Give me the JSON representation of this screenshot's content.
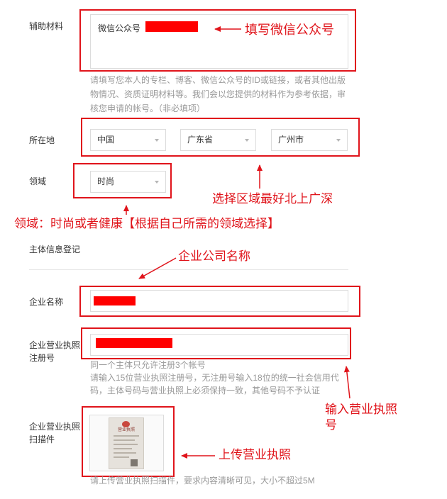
{
  "form": {
    "aux": {
      "label": "辅助材料",
      "value": "微信公众号",
      "hint": [
        "请填写您本人的专栏、博客、微信公众号的ID或链接，或者其他出版",
        "物情况、资质证明材料等。我们会以您提供的材料作为参考依据，审",
        "核您申请的帐号。（非必填项）"
      ]
    },
    "location": {
      "label": "所在地",
      "country": "中国",
      "province": "广东省",
      "city": "广州市"
    },
    "field": {
      "label": "领域",
      "value": "时尚"
    },
    "subject_section": "主体信息登记",
    "company_name": {
      "label": "企业名称"
    },
    "license_number": {
      "label_line1": "企业营业执照",
      "label_line2": "注册号",
      "hint": [
        "同一个主体只允许注册3个帐号",
        "请输入15位营业执照注册号，无注册号输入18位的统一社会信用代",
        "码，主体号码与营业执照上必须保持一致，其他号码不予认证"
      ]
    },
    "license_scan": {
      "label_line1": "企业营业执照",
      "label_line2": "扫描件",
      "doc_title": "营业执照",
      "hint": "请上传营业执照扫描件，要求内容清晰可见，大小不超过5M"
    }
  },
  "annotations": {
    "fill_wechat": "填写微信公众号",
    "choose_region": "选择区域最好北上广深",
    "field_tip": "领域：时尚或者健康【根据自己所需的领域选择】",
    "company_name": "企业公司名称",
    "enter_license_line1": "输入营业执照",
    "enter_license_line2": "号",
    "upload_license": "上传营业执照"
  },
  "colors": {
    "annotation_red": "#e0141b",
    "redaction_red": "#ff0000",
    "hint_gray": "#999999"
  }
}
